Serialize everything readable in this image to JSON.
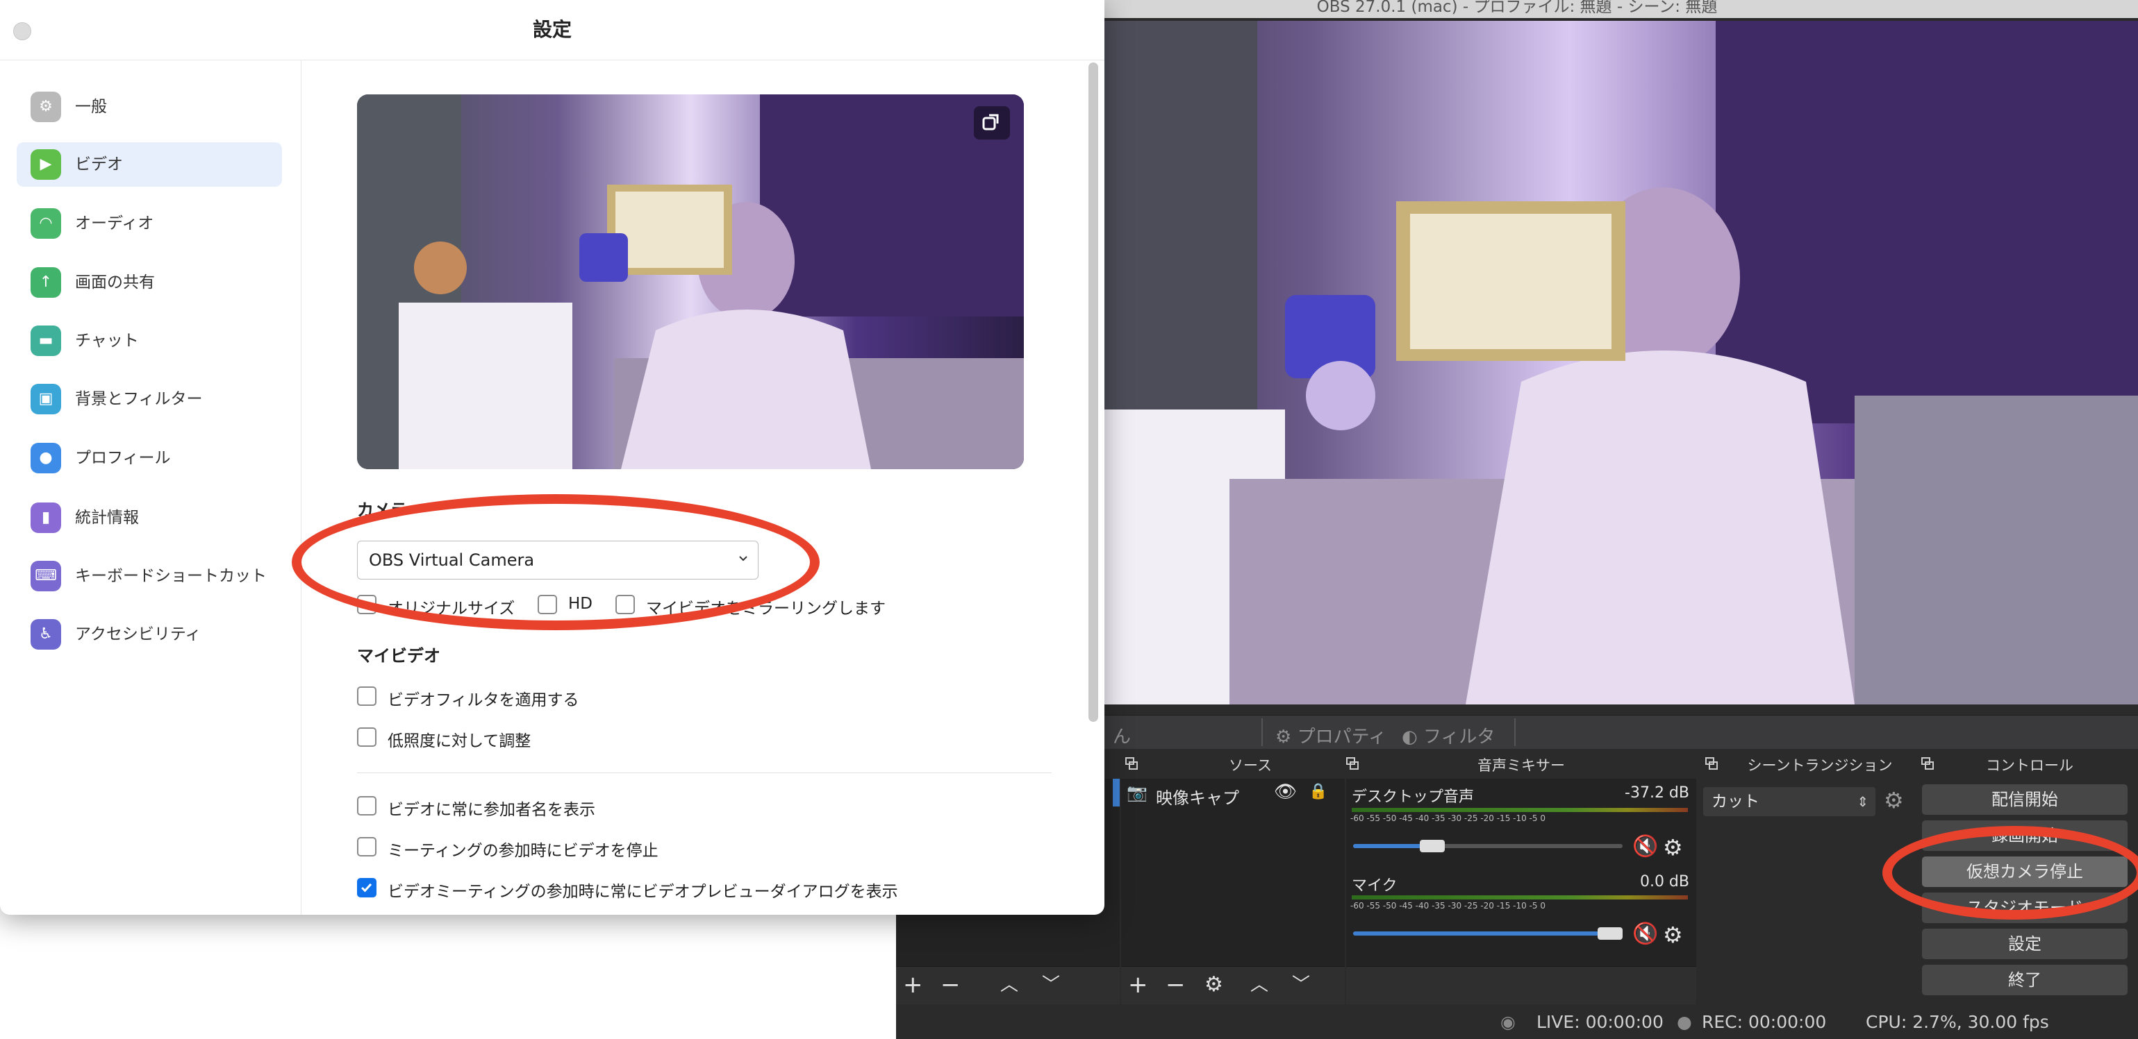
{
  "obs": {
    "window_title": "OBS 27.0.1 (mac) - プロファイル: 無題 - シーン: 無題",
    "subbar": {
      "scene_label": "ん",
      "properties_label": "プロパティ",
      "filters_label": "フィルタ"
    },
    "docks": {
      "sources_title": "ソース",
      "mixer_title": "音声ミキサー",
      "transition_title": "シーントランジション",
      "controls_title": "コントロール"
    },
    "sources": [
      {
        "name": "映像キャプ",
        "visible": true,
        "locked": false
      }
    ],
    "mixer": {
      "scale": "-60 -55 -50 -45 -40 -35 -30 -25 -20 -15 -10 -5 0",
      "channels": [
        {
          "name": "デスクトップ音声",
          "db": "-37.2 dB",
          "volume": 0.25,
          "muted": true
        },
        {
          "name": "マイク",
          "db": "0.0 dB",
          "volume": 0.97,
          "muted": true
        }
      ]
    },
    "transition": {
      "selected": "カット"
    },
    "controls": {
      "start_streaming": "配信開始",
      "start_recording": "録画開始",
      "stop_virtual_camera": "仮想カメラ停止",
      "studio_mode": "スタジオモード",
      "settings": "設定",
      "exit": "終了"
    },
    "status": {
      "live": "LIVE: 00:00:00",
      "rec": "REC: 00:00:00",
      "cpu": "CPU: 2.7%, 30.00 fps"
    }
  },
  "zoom_settings": {
    "title": "設定",
    "nav": [
      {
        "label": "一般",
        "icon": "gear-icon",
        "color": "#b9b9b9"
      },
      {
        "label": "ビデオ",
        "icon": "video-camera-icon",
        "color": "#5fbf4a",
        "active": true
      },
      {
        "label": "オーディオ",
        "icon": "headphones-icon",
        "color": "#49b86a"
      },
      {
        "label": "画面の共有",
        "icon": "share-screen-icon",
        "color": "#42b36b"
      },
      {
        "label": "チャット",
        "icon": "chat-bubble-icon",
        "color": "#3fb09a"
      },
      {
        "label": "背景とフィルター",
        "icon": "background-icon",
        "color": "#3aa6d8"
      },
      {
        "label": "プロフィール",
        "icon": "person-icon",
        "color": "#3d8de8"
      },
      {
        "label": "統計情報",
        "icon": "bar-chart-icon",
        "color": "#8a6bd6"
      },
      {
        "label": "キーボードショートカット",
        "icon": "keyboard-icon",
        "color": "#7a69d0"
      },
      {
        "label": "アクセシビリティ",
        "icon": "accessibility-icon",
        "color": "#6d68cf"
      }
    ],
    "camera_label": "カメラ",
    "camera_value": "OBS Virtual Camera",
    "options_row": [
      {
        "label": "オリジナルサイズ",
        "checked": false
      },
      {
        "label": "HD",
        "checked": false
      },
      {
        "label": "マイビデオをミラーリングします",
        "checked": false
      }
    ],
    "my_video_label": "マイビデオ",
    "my_video_options": [
      {
        "label": "ビデオフィルタを適用する",
        "checked": false
      },
      {
        "label": "低照度に対して調整",
        "checked": false
      }
    ],
    "meeting_options": [
      {
        "label": "ビデオに常に参加者名を表示",
        "checked": false
      },
      {
        "label": "ミーティングの参加時にビデオを停止",
        "checked": false
      },
      {
        "label": "ビデオミーティングの参加時に常にビデオプレビューダイアログを表示",
        "checked": true
      }
    ]
  },
  "colors": {
    "highlight": "#e8412c",
    "accent": "#0e71eb",
    "obs_bg": "#2b2b2b"
  }
}
